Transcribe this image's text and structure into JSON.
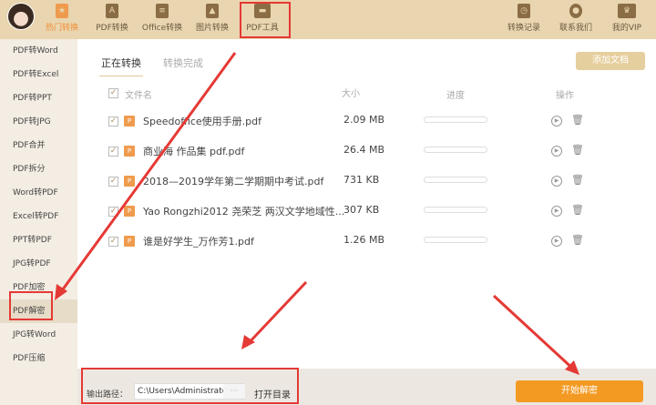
{
  "nav": [
    {
      "label": "热门转换",
      "icon": "star-icon"
    },
    {
      "label": "PDF转换",
      "icon": "pdf-icon"
    },
    {
      "label": "Office转换",
      "icon": "document-icon"
    },
    {
      "label": "图片转换",
      "icon": "image-icon"
    },
    {
      "label": "PDF工具",
      "icon": "toolbox-icon"
    }
  ],
  "nav_right": [
    {
      "label": "转换记录",
      "icon": "clock-icon"
    },
    {
      "label": "联系我们",
      "icon": "headset-icon"
    },
    {
      "label": "我的VIP",
      "icon": "crown-icon"
    }
  ],
  "sidebar": [
    "PDF转Word",
    "PDF转Excel",
    "PDF转PPT",
    "PDF转JPG",
    "PDF合并",
    "PDF拆分",
    "Word转PDF",
    "Excel转PDF",
    "PPT转PDF",
    "JPG转PDF",
    "PDF加密",
    "PDF解密",
    "JPG转Word",
    "PDF压缩"
  ],
  "tabs": {
    "active": "正在转换",
    "done": "转换完成"
  },
  "add_button": "添加文档",
  "columns": {
    "name": "文件名",
    "size": "大小",
    "progress": "进度",
    "action": "操作"
  },
  "files": [
    {
      "name": "Speedoffice使用手册.pdf",
      "size": "2.09 MB",
      "progress": 0
    },
    {
      "name": "商业海 作品集 pdf.pdf",
      "size": "26.4 MB",
      "progress": 0
    },
    {
      "name": "2018—2019学年第二学期期中考试.pdf",
      "size": "731 KB",
      "progress": 0
    },
    {
      "name": "Yao Rongzhi2012 尧荣芝 两汉文学地域性...",
      "size": "307 KB",
      "progress": 0
    },
    {
      "name": "谁是好学生_万作芳1.pdf",
      "size": "1.26 MB",
      "progress": 0
    }
  ],
  "output": {
    "label": "输出路径：",
    "path": "C:\\Users\\Administrator\\",
    "browse": "···",
    "open": "打开目录"
  },
  "start_button": "开始解密",
  "colors": {
    "accent": "#f39a23",
    "topbar": "#e9d5af",
    "annotation": "#e53935"
  }
}
